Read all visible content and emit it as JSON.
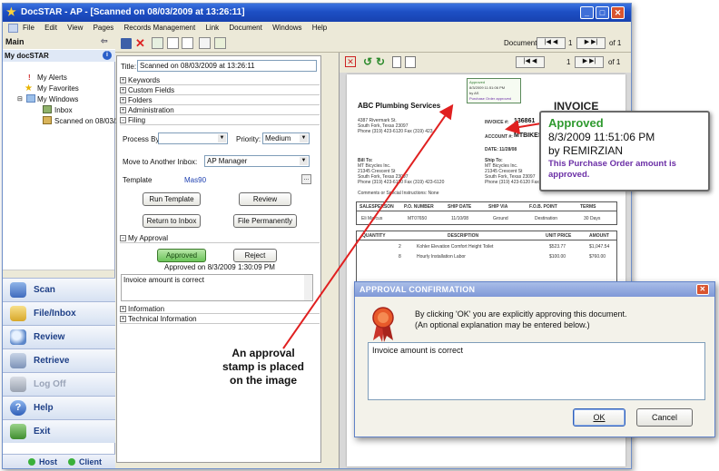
{
  "window": {
    "title": "DocSTAR - AP - [Scanned on 08/03/2009 at 13:26:11]"
  },
  "menu": [
    "File",
    "Edit",
    "View",
    "Pages",
    "Records Management",
    "Link",
    "Document",
    "Windows",
    "Help"
  ],
  "doc_nav": {
    "label": "Document",
    "value": "1",
    "of": "of 1"
  },
  "page_nav": {
    "value": "1",
    "of": "of 1"
  },
  "left": {
    "main_title": "Main",
    "root": "My docSTAR",
    "tree": [
      "My Alerts",
      "My Favorites",
      "My Windows",
      "Inbox",
      "Scanned on 08/03/2"
    ],
    "nav": [
      "Scan",
      "File/Inbox",
      "Review",
      "Retrieve",
      "Log Off",
      "Help",
      "Exit"
    ],
    "status": {
      "host": "Host",
      "client": "Client"
    }
  },
  "form": {
    "title_label": "Title:",
    "title_value": "Scanned on 08/03/2009 at 13:26:11",
    "sections": [
      "Keywords",
      "Custom Fields",
      "Folders",
      "Administration",
      "Filing"
    ],
    "process_by_label": "Process By:",
    "process_by_value": "",
    "priority_label": "Priority:",
    "priority_value": "Medium",
    "move_label": "Move to Another Inbox:",
    "move_value": "AP Manager",
    "template_label": "Template",
    "template_value": "Mas90",
    "buttons": {
      "run_template": "Run Template",
      "review": "Review",
      "return_inbox": "Return to Inbox",
      "file_perm": "File Permanently"
    },
    "approval_section": "My Approval",
    "approved_btn": "Approved",
    "reject_btn": "Reject",
    "approved_on": "Approved on 8/3/2009 1:30:09 PM",
    "note": "Invoice amount is correct",
    "bottom_sections": [
      "Information",
      "Technical Information"
    ]
  },
  "invoice": {
    "company": "ABC Plumbing Services",
    "heading": "INVOICE",
    "address": [
      "4387 Rivermark St.",
      "South Fork, Texas 23097",
      "Phone (319) 423-6120  Fax (319) 423"
    ],
    "invoice_no_label": "INVOICE #:",
    "invoice_no": "136861",
    "account_label": "ACCOUNT #:",
    "account": "MTBIKES",
    "date_label": "DATE:",
    "date": "11/28/08",
    "bill_to": [
      "Bill To:",
      "MT Bicycles Inc.",
      "21345 Crescent St",
      "South Fork, Texas 23097",
      "Phone (319) 423-6120  Fax (319) 423-6120"
    ],
    "ship_to": [
      "Ship To:",
      "MT Bicycles Inc.",
      "21345 Crescent St",
      "South Fork, Texas 23097",
      "Phone (319) 423-6120  Fax (319)"
    ],
    "comments": "Comments or Special Instructions: None",
    "order_headers": [
      "SALESPERSON",
      "P.O. NUMBER",
      "SHIP DATE",
      "SHIP VIA",
      "F.O.B. POINT",
      "TERMS"
    ],
    "order_row": [
      "Eli Marcus",
      "MT07650",
      "11/10/08",
      "Ground",
      "Destination",
      "30 Days"
    ],
    "item_headers": [
      "QUANTITY",
      "DESCRIPTION",
      "UNIT PRICE",
      "AMOUNT"
    ],
    "items": [
      {
        "qty": "2",
        "desc": "Kohler Elevation Comfort Height Toilet",
        "unit": "$523.77",
        "amount": "$1,047.54"
      },
      {
        "qty": "8",
        "desc": "Hourly Installation Labor",
        "unit": "$100.00",
        "amount": "$760.00"
      }
    ],
    "stamp_mini": [
      "Approved",
      "8/3/2009 11:51:06 PM",
      "by AS",
      "Purchase Order approved"
    ]
  },
  "stamp": {
    "status": "Approved",
    "datetime": "8/3/2009 11:51:06 PM",
    "by": "by REMIRZIAN",
    "note": "This Purchase Order amount is approved."
  },
  "annotation": [
    "An approval",
    "stamp is placed",
    "on the image"
  ],
  "dialog": {
    "title": "APPROVAL CONFIRMATION",
    "message1": "By clicking 'OK' you are explicitly approving this document.",
    "message2": "(An optional explanation may be entered below.)",
    "text": "Invoice amount is correct",
    "ok": "OK",
    "cancel": "Cancel"
  },
  "colors": {
    "approved_green": "#2f9a2f",
    "stamp_purple": "#6b2fa6",
    "arrow_red": "#e02020",
    "title_blue": "#1d4fc4"
  }
}
